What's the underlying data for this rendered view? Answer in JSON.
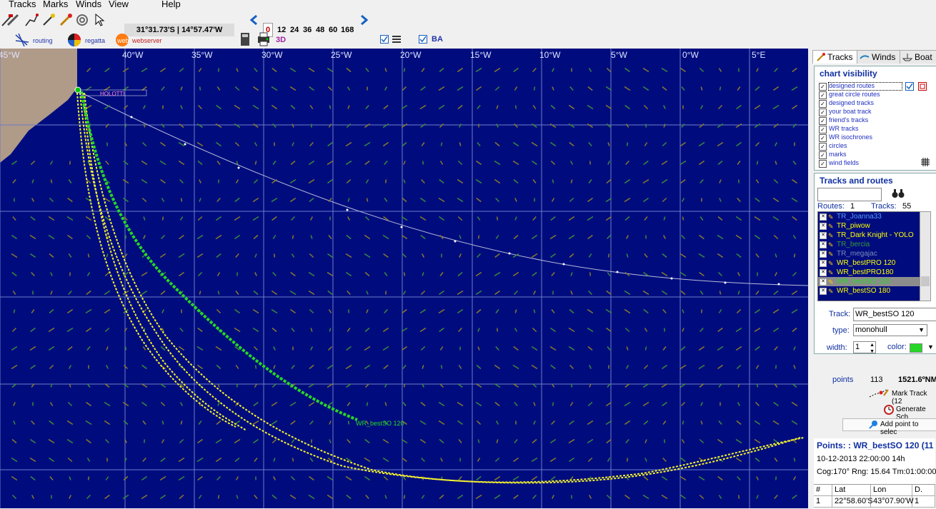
{
  "menubar": [
    "Tracks",
    "Marks",
    "Winds",
    "View",
    "Help"
  ],
  "toolbar": {
    "coords": "31°31.73'S | 14°57.47'W",
    "time_steps": [
      "0",
      "12",
      "24",
      "36",
      "48",
      "60",
      "168"
    ],
    "selected_step": "0",
    "routing_label": "routing",
    "regatta_label": "regatta",
    "webserver_label": "webserver",
    "threed_label": "3D",
    "ba_label": "BA"
  },
  "map": {
    "longitude_labels": [
      "45°W",
      "40°W",
      "35°W",
      "30°W",
      "25°W",
      "20°W",
      "15°W",
      "10°W",
      "5°W",
      "0°W",
      "5°E"
    ],
    "start_label": "HOLOTTI",
    "green_end_label": "WR_bestSO 120",
    "colors": {
      "ocean": "#000c7e",
      "land": "#b09a88",
      "grid": "#6c7cc8",
      "great_circle": "#b8bcd8",
      "green_track": "#27d627",
      "yellow_track": "#f4f22e"
    }
  },
  "panel": {
    "tabs": [
      "Tracks",
      "Winds",
      "Boat"
    ],
    "chart_visibility": {
      "title": "chart visibility",
      "items": [
        "designed routes",
        "great circle routes",
        "designed tracks",
        "your boat track",
        "friend's tracks",
        "WR tracks",
        "WR isochrones",
        "circles",
        "marks",
        "wind fields"
      ]
    },
    "tracks_routes": {
      "title": "Tracks and routes",
      "search_value": "",
      "routes_label": "Routes:",
      "routes_count": "1",
      "tracks_label": "Tracks:",
      "tracks_count": "55",
      "list": [
        {
          "name": "TR_Joanna33",
          "color": "#5b9bff"
        },
        {
          "name": "TR_piwow",
          "color": "#ffff00"
        },
        {
          "name": "TR_Dark Knight - YOLO",
          "color": "#ffff00"
        },
        {
          "name": "TR_bercia",
          "color": "#3a9a3a"
        },
        {
          "name": "TR_megajac",
          "color": "#7b8bb8"
        },
        {
          "name": "WR_bestPRO 120",
          "color": "#ffff00"
        },
        {
          "name": "WR_bestPRO180",
          "color": "#ffff00"
        },
        {
          "name": "WR_bestSO 120",
          "color": "#27d627"
        },
        {
          "name": "WR_bestSO 180",
          "color": "#ffff00"
        }
      ],
      "selected_index": 7
    },
    "track_detail": {
      "track_label": "Track:",
      "track_value": "WR_bestSO 120",
      "type_label": "type:",
      "type_value": "monohull",
      "width_label": "width:",
      "width_value": "1",
      "color_label": "color:",
      "color_value": "#27d627",
      "points_label": "points",
      "points_value": "113",
      "distance": "1521.6ºNM",
      "mark_track": "Mark Track (12",
      "generate": "Generate Sch",
      "add_point": "Add point to selec"
    },
    "points": {
      "title": "Points: : WR_bestSO 120 (11",
      "line1": "10-12-2013 22:00:00 14h",
      "line2": "Cog:170° Rng: 15.64 Tm:01:00:00",
      "headers": [
        "#",
        "Lat",
        "Lon",
        "D."
      ],
      "row1": [
        "1",
        "22°58.60'S",
        "43°07.90'W",
        "1"
      ]
    }
  }
}
